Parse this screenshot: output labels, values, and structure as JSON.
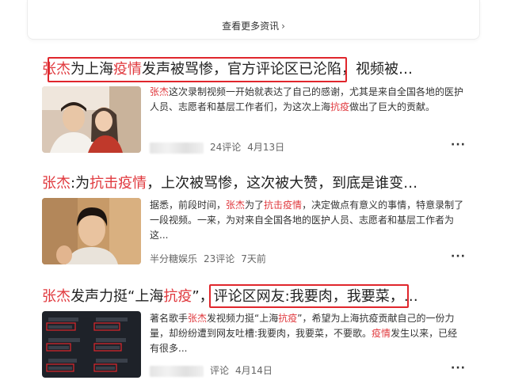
{
  "more": {
    "label": "查看更多资讯",
    "chevron": "›"
  },
  "articles": [
    {
      "title_parts": [
        {
          "text": "张杰",
          "hl": true
        },
        {
          "text": "为上海",
          "hl": false
        },
        {
          "text": "疫情",
          "hl": true
        },
        {
          "text": "发声被骂惨，官方评论区已沦陷，视频被…",
          "hl": false
        }
      ],
      "snippet_parts": [
        {
          "text": "张杰",
          "hl": true
        },
        {
          "text": "这次录制视频一开始就表达了自己的感谢，尤其是来自全国各地的医护人员、志愿者和基层工作者们，为这次上海",
          "hl": false
        },
        {
          "text": "抗疫",
          "hl": true
        },
        {
          "text": "做出了巨大的贡献。",
          "hl": false
        }
      ],
      "source": "",
      "comments": "24评论",
      "date": "4月13日",
      "more_icon": "ellipsis-icon"
    },
    {
      "title_parts": [
        {
          "text": "张杰",
          "hl": true
        },
        {
          "text": ":为",
          "hl": false
        },
        {
          "text": "抗击疫情",
          "hl": true
        },
        {
          "text": "，上次被骂惨，这次被大赞，到底是谁变…",
          "hl": false
        }
      ],
      "snippet_parts": [
        {
          "text": "据悉，前段时间，",
          "hl": false
        },
        {
          "text": "张杰",
          "hl": true
        },
        {
          "text": "为了",
          "hl": false
        },
        {
          "text": "抗击疫情",
          "hl": true
        },
        {
          "text": "，决定做点有意义的事情，特意录制了一段视频。一来，为对来自全国各地的医护人员、志愿者和基层工作者为这...",
          "hl": false
        }
      ],
      "source": "半分糖娱乐",
      "comments": "23评论",
      "date": "7天前",
      "more_icon": "ellipsis-icon"
    },
    {
      "title_parts": [
        {
          "text": "张杰",
          "hl": true
        },
        {
          "text": "发声力挺“上海",
          "hl": false
        },
        {
          "text": "抗疫",
          "hl": true
        },
        {
          "text": "”，评论区网友:我要肉，我要菜，…",
          "hl": false
        }
      ],
      "snippet_parts": [
        {
          "text": "著名歌手",
          "hl": false
        },
        {
          "text": "张杰",
          "hl": true
        },
        {
          "text": "发视频力挺“上海",
          "hl": false
        },
        {
          "text": "抗疫",
          "hl": true
        },
        {
          "text": "”，希望为上海抗疫贡献自己的一份力量，却纷纷遭到网友吐槽:我要肉，我要菜，不要歌。",
          "hl": false
        },
        {
          "text": "疫情",
          "hl": true
        },
        {
          "text": "发生以来，已经有很多...",
          "hl": false
        }
      ],
      "source": "",
      "comments": "评论",
      "date": "4月14日",
      "more_icon": "ellipsis-icon"
    }
  ],
  "colors": {
    "highlight": "#e0393e",
    "annotation_box": "#e0262c"
  }
}
